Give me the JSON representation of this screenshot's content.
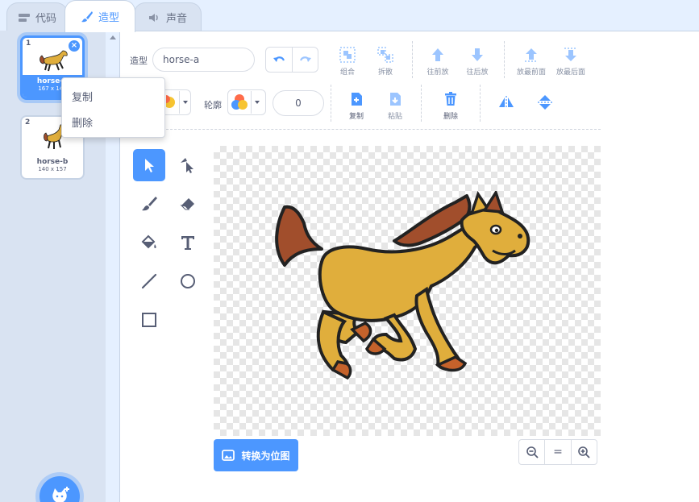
{
  "tabs": [
    {
      "label": "代码",
      "icon": "code-icon"
    },
    {
      "label": "造型",
      "icon": "brush-icon"
    },
    {
      "label": "声音",
      "icon": "speaker-icon"
    }
  ],
  "costumes": [
    {
      "number": "1",
      "name": "horse-a",
      "size": "167 x 145",
      "selected": true
    },
    {
      "number": "2",
      "name": "horse-b",
      "size": "140 x 157",
      "selected": false
    }
  ],
  "context_menu": {
    "items": [
      "复制",
      "删除"
    ]
  },
  "toolbar": {
    "costume_label": "造型",
    "costume_name": "horse-a",
    "outline_label": "轮廓",
    "outline_width": "0",
    "group": "组合",
    "ungroup": "拆散",
    "forward": "往前放",
    "backward": "往后放",
    "front": "放最前面",
    "back": "放最后面",
    "copy": "复制",
    "paste": "粘贴",
    "delete": "删除"
  },
  "convert_button": "转换为位图",
  "zoom": {
    "out": "−",
    "reset": "=",
    "in": "+"
  },
  "colors": {
    "accent": "#4c97ff",
    "horse_body": "#e0ae3c",
    "horse_mane": "#a14e2c"
  }
}
